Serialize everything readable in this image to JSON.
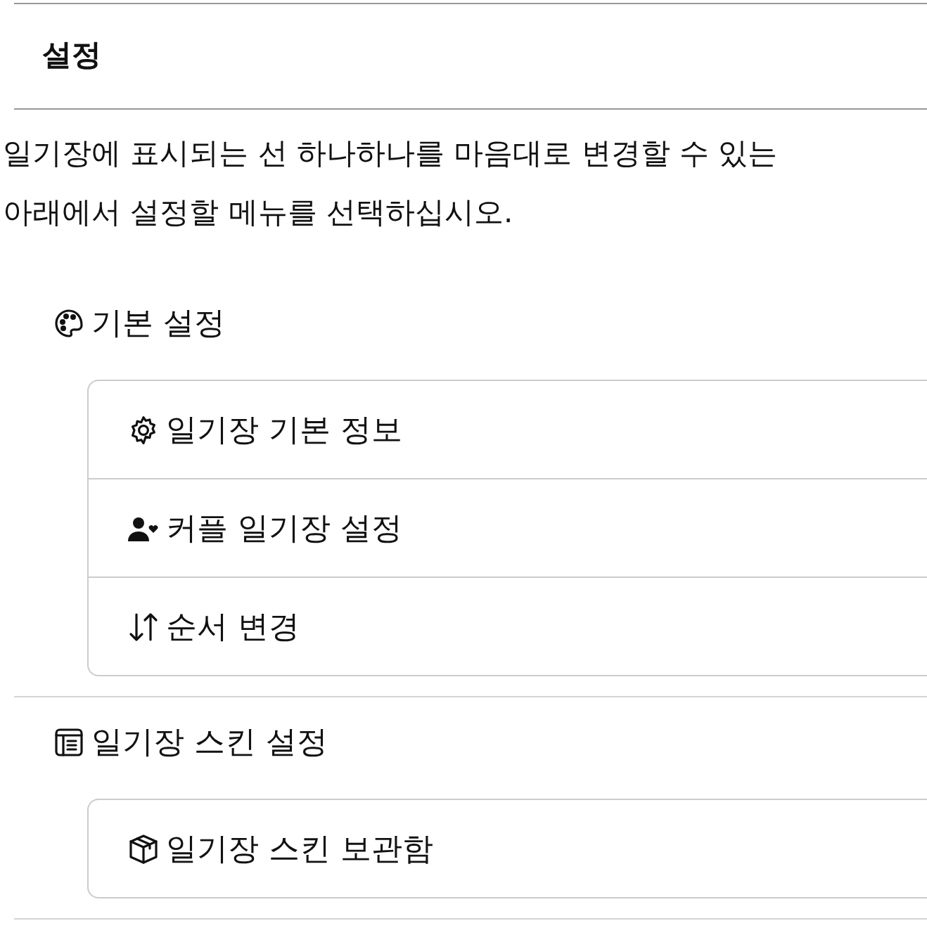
{
  "title": "설정",
  "intro": [
    "일기장에 표시되는 선 하나하나를 마음대로 변경할 수 있는",
    "아래에서 설정할 메뉴를 선택하십시오."
  ],
  "sections": [
    {
      "label": "기본 설정",
      "items": [
        {
          "label": "일기장 기본 정보"
        },
        {
          "label": "커플 일기장 설정"
        },
        {
          "label": "순서 변경"
        }
      ]
    },
    {
      "label": "일기장 스킨 설정",
      "items": [
        {
          "label": "일기장 스킨 보관함"
        }
      ]
    }
  ]
}
